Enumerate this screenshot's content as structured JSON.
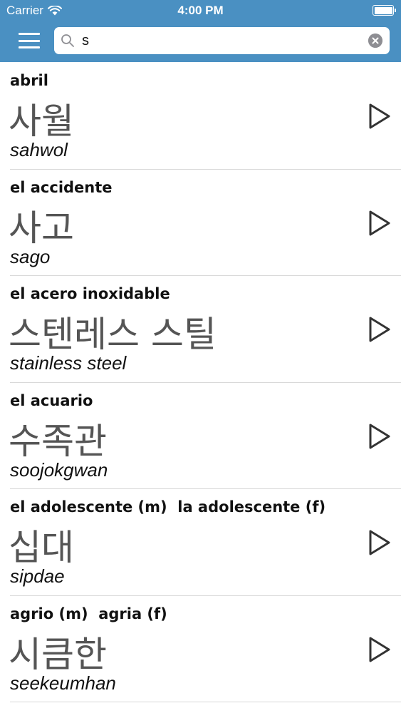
{
  "status_bar": {
    "carrier": "Carrier",
    "time": "4:00 PM"
  },
  "search": {
    "value": "s"
  },
  "icons": {
    "menu": "hamburger-menu-icon",
    "search": "magnifier-icon",
    "clear": "clear-x-circle-icon",
    "play": "play-triangle-outline-icon"
  },
  "colors": {
    "header": "#4a90c2",
    "hangul_text": "#555555",
    "divider": "#d9d9d9"
  },
  "entries": [
    {
      "term": "abril",
      "hangul": "사월",
      "romanization": "sahwol"
    },
    {
      "term": "el accidente",
      "hangul": "사고",
      "romanization": "sago"
    },
    {
      "term": "el acero inoxidable",
      "hangul": "스텐레스 스틸",
      "romanization": "stainless steel"
    },
    {
      "term": "el acuario",
      "hangul": "수족관",
      "romanization": "soojokgwan"
    },
    {
      "term": "el adolescente (m)  la adolescente (f)",
      "hangul": "십대",
      "romanization": "sipdae"
    },
    {
      "term": "agrio (m)  agria (f)",
      "hangul": "시큼한",
      "romanization": "seekeumhan"
    }
  ]
}
